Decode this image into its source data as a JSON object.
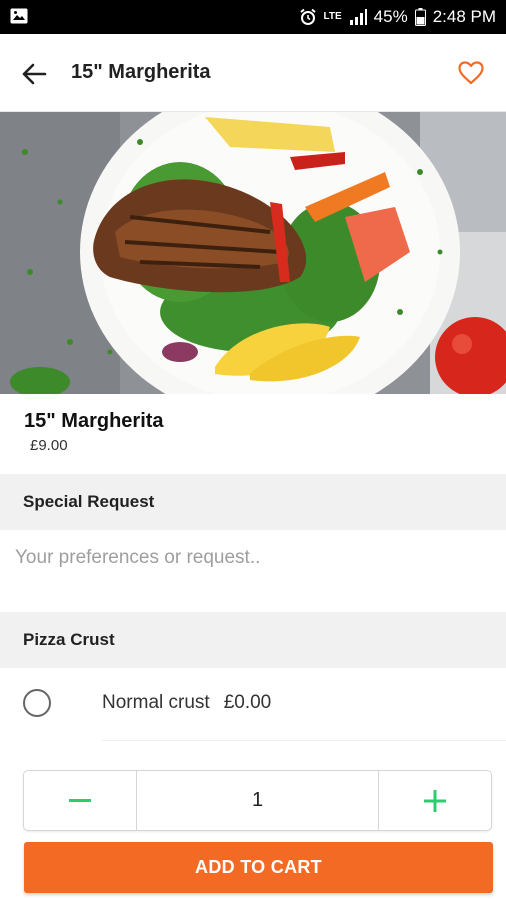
{
  "status_bar": {
    "network": "LTE",
    "battery": "45%",
    "time": "2:48 PM"
  },
  "header": {
    "title": "15\" Margherita"
  },
  "product": {
    "name": "15\" Margherita",
    "price": "£9.00"
  },
  "special_request": {
    "heading": "Special Request",
    "placeholder": "Your preferences or request..",
    "value": ""
  },
  "pizza_crust": {
    "heading": "Pizza Crust",
    "options": [
      {
        "label": "Normal crust",
        "price": "£0.00",
        "selected": false
      }
    ]
  },
  "quantity": {
    "value": "1"
  },
  "actions": {
    "add_to_cart": "ADD TO CART"
  },
  "colors": {
    "accent": "#f26a24",
    "stepper_icon": "#2ecc71",
    "section_bg": "#f1f1f1"
  },
  "icons": {
    "back": "arrow-left-icon",
    "favorite": "heart-outline-icon",
    "minus": "minus-icon",
    "plus": "plus-icon"
  }
}
